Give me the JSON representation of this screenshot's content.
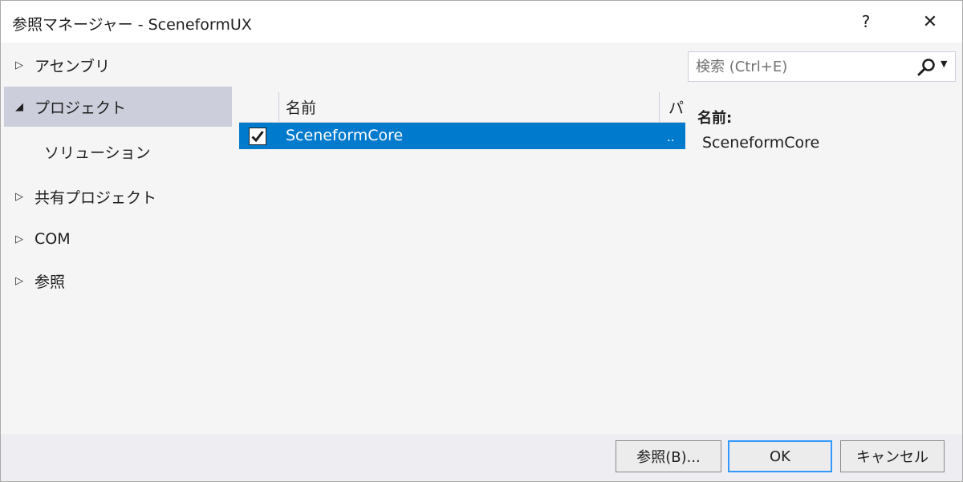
{
  "window": {
    "title": "参照マネージャー - SceneformUX",
    "help_label": "?",
    "close_label": "✕"
  },
  "sidebar": {
    "items": [
      {
        "label": "アセンブリ",
        "arrow": "▷"
      },
      {
        "label": "プロジェクト",
        "arrow": "◢"
      },
      {
        "label": "ソリューション",
        "arrow": ""
      },
      {
        "label": "共有プロジェクト",
        "arrow": "▷"
      },
      {
        "label": "COM",
        "arrow": "▷"
      },
      {
        "label": "参照",
        "arrow": "▷"
      }
    ]
  },
  "search": {
    "placeholder": "検索 (Ctrl+E)",
    "dropdown_glyph": "▼"
  },
  "list": {
    "columns": {
      "name": "名前",
      "path": "パス"
    },
    "rows": [
      {
        "checked": true,
        "name": "SceneformCore",
        "path": ".."
      }
    ]
  },
  "details": {
    "name_label": "名前:",
    "name_value": "SceneformCore"
  },
  "footer": {
    "browse_label": "参照(B)...",
    "ok_label": "OK",
    "cancel_label": "キャンセル"
  },
  "colors": {
    "selection": "#007acc",
    "nav_selected": "#cccedb",
    "ok_border": "#3399ff"
  }
}
